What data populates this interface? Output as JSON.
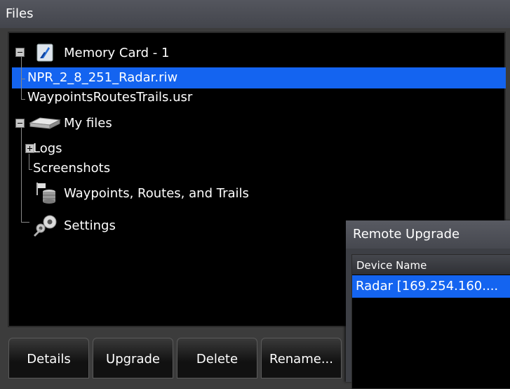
{
  "window": {
    "title": "Files"
  },
  "tree": {
    "memory_card": {
      "label": "Memory Card - 1",
      "children": [
        "NPR_2_8_251_Radar.riw",
        "WaypointsRoutesTrails.usr"
      ]
    },
    "my_files": {
      "label": "My files",
      "children": [
        "Logs",
        "Screenshots"
      ]
    },
    "waypoints": {
      "label": "Waypoints, Routes, and Trails"
    },
    "settings": {
      "label": "Settings"
    }
  },
  "buttons": [
    "Details",
    "Upgrade",
    "Delete",
    "Rename..."
  ],
  "remote_upgrade": {
    "title": "Remote Upgrade",
    "column": "Device Name",
    "rows": [
      "Radar [169.254.160...."
    ]
  },
  "colors": {
    "selection": "#1464f0",
    "background": "#000000"
  }
}
